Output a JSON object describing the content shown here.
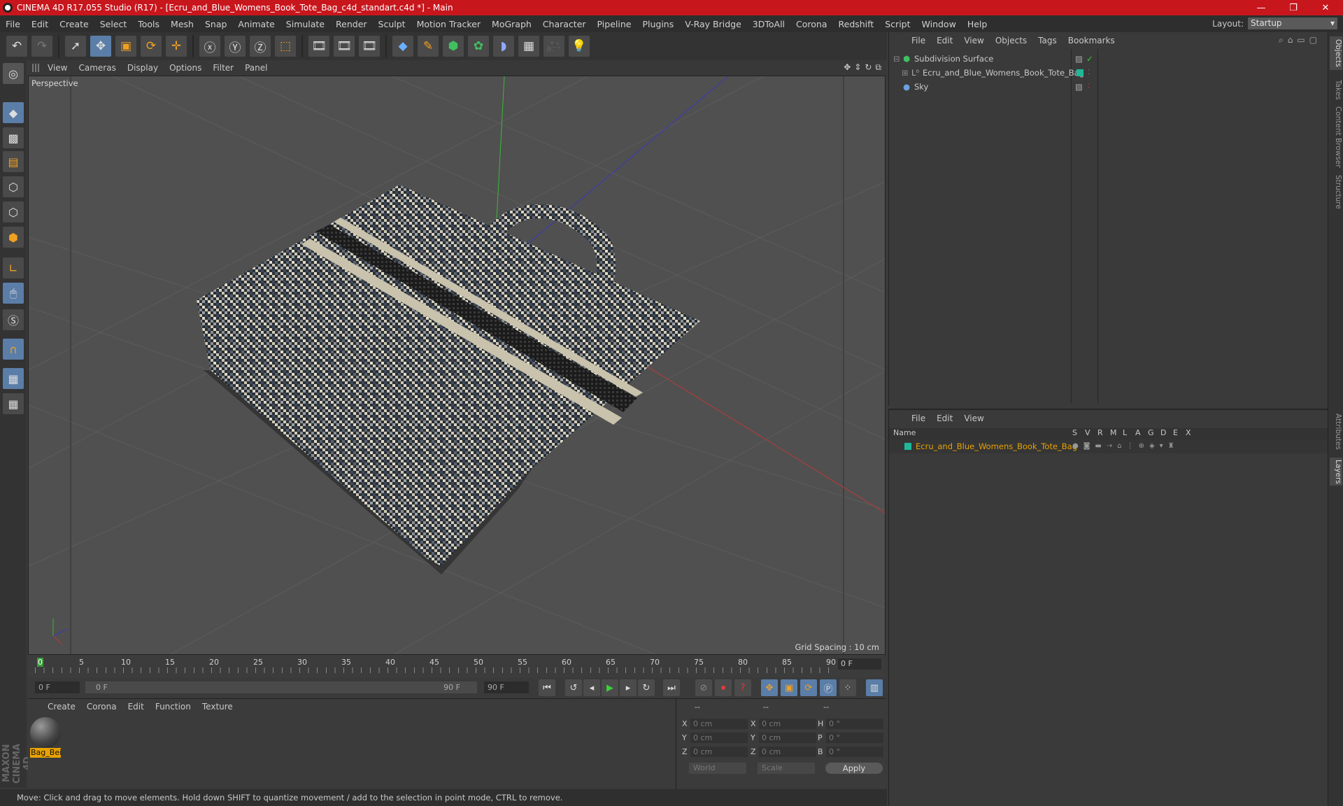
{
  "title": "CINEMA 4D R17.055 Studio (R17) - [Ecru_and_Blue_Womens_Book_Tote_Bag_c4d_standart.c4d *] - Main",
  "window_controls": {
    "minimize": "—",
    "maximize": "❐",
    "close": "✕"
  },
  "menu": [
    "File",
    "Edit",
    "Create",
    "Select",
    "Tools",
    "Mesh",
    "Snap",
    "Animate",
    "Simulate",
    "Render",
    "Sculpt",
    "Motion Tracker",
    "MoGraph",
    "Character",
    "Pipeline",
    "Plugins",
    "V-Ray Bridge",
    "3DToAll",
    "Corona",
    "Redshift",
    "Script",
    "Window",
    "Help"
  ],
  "layout": {
    "label": "Layout:",
    "value": "Startup"
  },
  "viewport": {
    "menu": [
      "View",
      "Cameras",
      "Display",
      "Options",
      "Filter",
      "Panel"
    ],
    "label": "Perspective",
    "grid_spacing": "Grid Spacing : 10 cm"
  },
  "timeline": {
    "ticks": [
      "0",
      "5",
      "10",
      "15",
      "20",
      "25",
      "30",
      "35",
      "40",
      "45",
      "50",
      "55",
      "60",
      "65",
      "70",
      "75",
      "80",
      "85",
      "90"
    ],
    "current_frame": "0 F"
  },
  "playback": {
    "start": "0 F",
    "range_start": "0 F",
    "range_end": "90 F",
    "end": "90 F"
  },
  "material_manager": {
    "menu": [
      "Create",
      "Corona",
      "Edit",
      "Function",
      "Texture"
    ],
    "materials": [
      {
        "name": "Bag_Beige"
      }
    ]
  },
  "coordinates": {
    "header": [
      "--",
      "--",
      "--"
    ],
    "rows": [
      {
        "a": "X",
        "av": "0 cm",
        "b": "X",
        "bv": "0 cm",
        "c": "H",
        "cv": "0 °"
      },
      {
        "a": "Y",
        "av": "0 cm",
        "b": "Y",
        "bv": "0 cm",
        "c": "P",
        "cv": "0 °"
      },
      {
        "a": "Z",
        "av": "0 cm",
        "b": "Z",
        "bv": "0 cm",
        "c": "B",
        "cv": "0 °"
      }
    ],
    "world": "World",
    "scale": "Scale",
    "apply": "Apply"
  },
  "status": "Move: Click and drag to move elements. Hold down SHIFT to quantize movement / add to the selection in point mode, CTRL to remove.",
  "object_manager": {
    "menu": [
      "File",
      "Edit",
      "View",
      "Objects",
      "Tags",
      "Bookmarks"
    ],
    "objects": [
      {
        "name": "Subdivision Surface"
      },
      {
        "name": "Ecru_and_Blue_Womens_Book_Tote_Bag"
      },
      {
        "name": "Sky"
      }
    ]
  },
  "layer_manager": {
    "menu": [
      "File",
      "Edit",
      "View"
    ],
    "columns": [
      "Name",
      "S",
      "V",
      "R",
      "M",
      "L",
      "A",
      "G",
      "D",
      "E",
      "X"
    ],
    "layers": [
      {
        "name": "Ecru_and_Blue_Womens_Book_Tote_Bag",
        "color": "#1fb89a"
      }
    ]
  },
  "side_tabs": [
    "Objects",
    "Takes",
    "Content Browser",
    "Structure",
    "Attributes",
    "Layers"
  ],
  "logo": {
    "line1": "MAXON",
    "line2": "CINEMA 4D"
  },
  "colors": {
    "titlebar": "#c8161d",
    "accent": "#e8a200",
    "selected_tool": "#5b7ea8"
  }
}
